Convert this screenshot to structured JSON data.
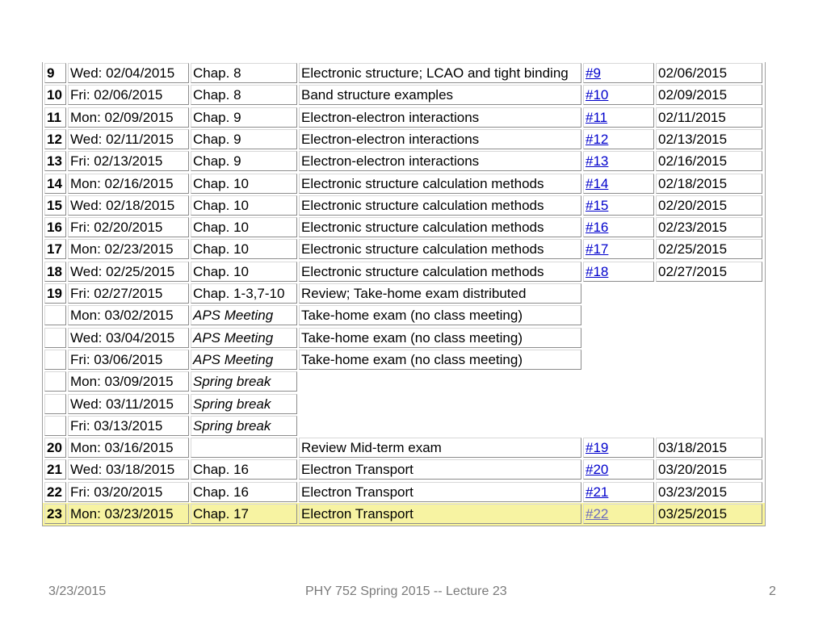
{
  "schedule": {
    "rows": [
      {
        "num": "9",
        "date": "Wed: 02/04/2015",
        "chapter": "Chap. 8",
        "topic": "Electronic structure; LCAO and tight binding",
        "hw": "#9",
        "due": "02/06/2015"
      },
      {
        "num": "10",
        "date": "Fri: 02/06/2015",
        "chapter": "Chap. 8",
        "topic": "Band structure examples",
        "hw": "#10",
        "due": "02/09/2015"
      },
      {
        "num": "11",
        "date": "Mon: 02/09/2015",
        "chapter": "Chap. 9",
        "topic": "Electron-electron interactions",
        "hw": "#11",
        "due": "02/11/2015"
      },
      {
        "num": "12",
        "date": "Wed: 02/11/2015",
        "chapter": "Chap. 9",
        "topic": "Electron-electron interactions",
        "hw": "#12",
        "due": "02/13/2015"
      },
      {
        "num": "13",
        "date": "Fri: 02/13/2015",
        "chapter": "Chap. 9",
        "topic": "Electron-electron interactions",
        "hw": "#13",
        "due": "02/16/2015"
      },
      {
        "num": "14",
        "date": "Mon: 02/16/2015",
        "chapter": "Chap. 10",
        "topic": "Electronic structure calculation methods",
        "hw": "#14",
        "due": "02/18/2015"
      },
      {
        "num": "15",
        "date": "Wed: 02/18/2015",
        "chapter": "Chap. 10",
        "topic": "Electronic structure calculation methods",
        "hw": "#15",
        "due": "02/20/2015"
      },
      {
        "num": "16",
        "date": "Fri: 02/20/2015",
        "chapter": "Chap. 10",
        "topic": "Electronic structure calculation methods",
        "hw": "#16",
        "due": "02/23/2015"
      },
      {
        "num": "17",
        "date": "Mon: 02/23/2015",
        "chapter": "Chap. 10",
        "topic": "Electronic structure calculation methods",
        "hw": "#17",
        "due": "02/25/2015"
      },
      {
        "num": "18",
        "date": "Wed: 02/25/2015",
        "chapter": "Chap. 10",
        "topic": "Electronic structure calculation methods",
        "hw": "#18",
        "due": "02/27/2015"
      },
      {
        "num": "19",
        "date": "Fri: 02/27/2015",
        "chapter": "Chap. 1-3,7-10",
        "topic": "Review; Take-home exam distributed"
      },
      {
        "num": "",
        "date": "Mon: 03/02/2015",
        "chapter": "APS Meeting",
        "chapter_italic": true,
        "topic": "Take-home exam (no class meeting)"
      },
      {
        "num": "",
        "date": "Wed: 03/04/2015",
        "chapter": "APS Meeting",
        "chapter_italic": true,
        "topic": "Take-home exam (no class meeting)"
      },
      {
        "num": "",
        "date": "Fri: 03/06/2015",
        "chapter": "APS Meeting",
        "chapter_italic": true,
        "topic": "Take-home exam (no class meeting)"
      },
      {
        "num": "",
        "date": "Mon: 03/09/2015",
        "chapter": "Spring break",
        "chapter_italic": true
      },
      {
        "num": "",
        "date": "Wed: 03/11/2015",
        "chapter": "Spring break",
        "chapter_italic": true
      },
      {
        "num": "",
        "date": "Fri: 03/13/2015",
        "chapter": "Spring break",
        "chapter_italic": true
      },
      {
        "num": "20",
        "date": "Mon: 03/16/2015",
        "chapter": "",
        "topic": "Review Mid-term exam",
        "hw": "#19",
        "due": "03/18/2015"
      },
      {
        "num": "21",
        "date": "Wed: 03/18/2015",
        "chapter": "Chap. 16",
        "topic": "Electron Transport",
        "hw": "#20",
        "due": "03/20/2015"
      },
      {
        "num": "22",
        "date": "Fri: 03/20/2015",
        "chapter": "Chap. 16",
        "topic": "Electron Transport",
        "hw": "#21",
        "due": "03/23/2015"
      },
      {
        "num": "23",
        "date": "Mon: 03/23/2015",
        "chapter": "Chap. 17",
        "topic": "Electron Transport",
        "hw": "#22",
        "due": "03/25/2015",
        "highlight": true
      }
    ],
    "highlight_color": "#fbf69a",
    "link_color": "#0000cc"
  },
  "footer": {
    "date": "3/23/2015",
    "title": "PHY 752  Spring 2015 -- Lecture 23",
    "page": "2"
  }
}
